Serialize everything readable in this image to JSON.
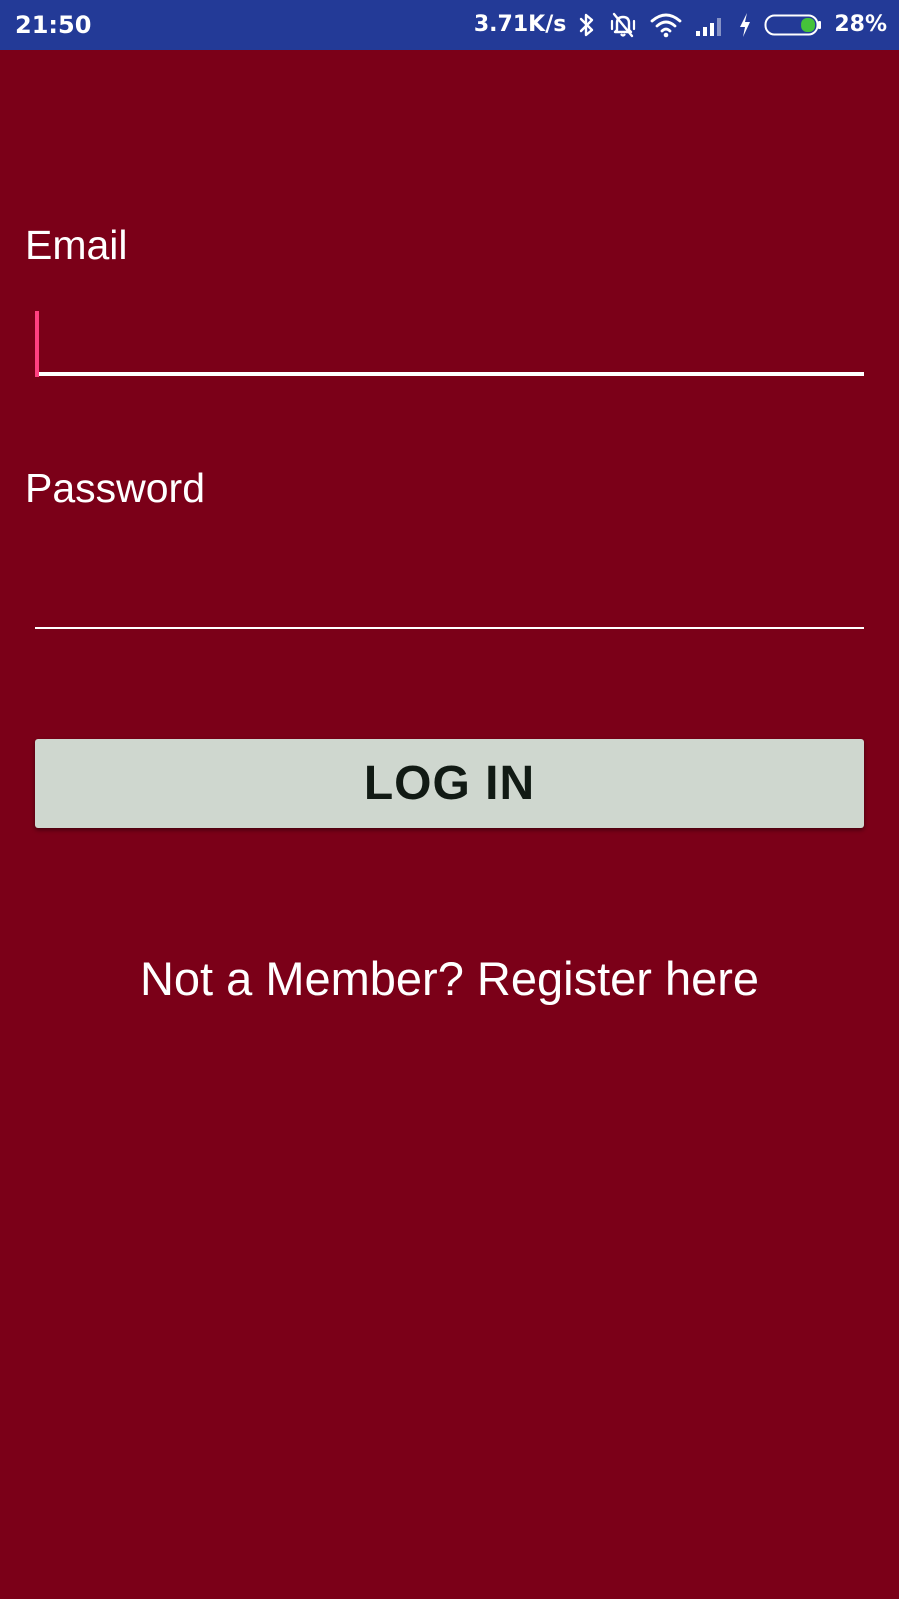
{
  "status_bar": {
    "time": "21:50",
    "network_speed": "3.71K/s",
    "battery_percent": "28%",
    "battery_level": 0.28,
    "icons": [
      "bluetooth-icon",
      "vibrate-icon",
      "wifi-icon",
      "signal-icon",
      "charging-icon",
      "battery-icon"
    ],
    "background_color": "#233a97"
  },
  "form": {
    "email": {
      "label": "Email",
      "value": ""
    },
    "password": {
      "label": "Password",
      "value": ""
    },
    "login_button_label": "LOG IN",
    "register_link_text": "Not a Member? Register here"
  },
  "colors": {
    "background": "#7b0018",
    "button": "#cfd7cf",
    "cursor": "#ff4081"
  }
}
